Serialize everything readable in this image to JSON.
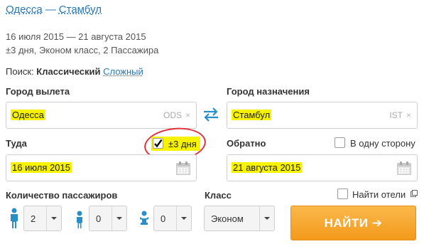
{
  "route": {
    "from": "Одесса",
    "separator": "—",
    "to": "Стамбул"
  },
  "summary": {
    "dates": "16 июля 2015 — 21 августа 2015",
    "details": "±3 дня, Эконом класс, 2 Пассажира"
  },
  "search_mode": {
    "label": "Поиск:",
    "current": "Классический",
    "alternative": "Сложный"
  },
  "origin": {
    "label": "Город вылета",
    "value": "Одесса",
    "code": "ODS",
    "clear": "×"
  },
  "destination": {
    "label": "Город назначения",
    "value": "Стамбул",
    "code": "IST",
    "clear": "×"
  },
  "depart": {
    "label": "Туда",
    "flex_label": "±3 дня",
    "flex_checked": true,
    "value": "16 июля 2015"
  },
  "return": {
    "label": "Обратно",
    "one_way_label": "В одну сторону",
    "one_way_checked": false,
    "value": "21 августа 2015"
  },
  "passengers": {
    "label": "Количество пассажиров",
    "adults": "2",
    "children": "0",
    "infants": "0"
  },
  "cabin": {
    "label": "Класс",
    "value": "Эконом"
  },
  "hotels": {
    "label": "Найти отели",
    "checked": false
  },
  "submit": {
    "label": "НАЙТИ ➔"
  },
  "colors": {
    "link": "#2a78b8",
    "highlight": "#f6f200",
    "button": "#f7a428",
    "annotation": "#e2303a",
    "icon": "#2a8fc8"
  }
}
